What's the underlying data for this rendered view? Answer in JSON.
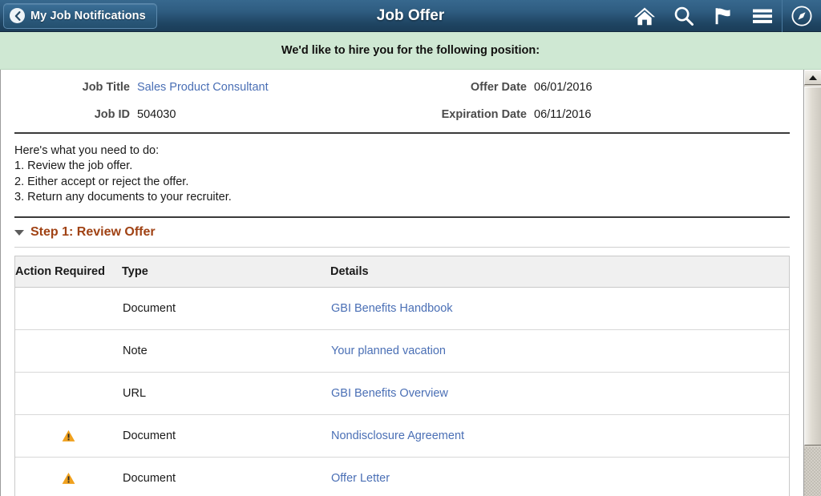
{
  "topbar": {
    "back_label": "My Job Notifications",
    "title": "Job Offer",
    "icons": [
      {
        "name": "home-icon",
        "label": "Home"
      },
      {
        "name": "search-icon",
        "label": "Search"
      },
      {
        "name": "flag-icon",
        "label": "Notifications"
      },
      {
        "name": "hamburger-menu-icon",
        "label": "Actions Menu"
      },
      {
        "name": "navigator-compass-icon",
        "label": "NavBar"
      }
    ]
  },
  "banner": {
    "text": "We'd like to hire you for the following position:"
  },
  "details": {
    "job_title_label": "Job Title",
    "job_title_value": "Sales Product Consultant",
    "job_id_label": "Job ID",
    "job_id_value": "504030",
    "offer_date_label": "Offer Date",
    "offer_date_value": "06/01/2016",
    "expiration_date_label": "Expiration Date",
    "expiration_date_value": "06/11/2016"
  },
  "instructions": {
    "heading": "Here's what you need to do:",
    "lines": [
      "1. Review the job offer.",
      "2. Either accept or reject the offer.",
      "3. Return any documents to your recruiter."
    ]
  },
  "step": {
    "title": "Step 1: Review Offer",
    "expanded": true
  },
  "table": {
    "columns": [
      "Action Required",
      "Type",
      "Details"
    ],
    "rows": [
      {
        "action_required": false,
        "type": "Document",
        "details": "GBI Benefits Handbook"
      },
      {
        "action_required": false,
        "type": "Note",
        "details": "Your planned vacation"
      },
      {
        "action_required": false,
        "type": "URL",
        "details": "GBI Benefits Overview"
      },
      {
        "action_required": true,
        "type": "Document",
        "details": "Nondisclosure Agreement"
      },
      {
        "action_required": true,
        "type": "Document",
        "details": "Offer Letter"
      }
    ]
  },
  "colors": {
    "header_blue": "#2f5d81",
    "banner_green": "#cfe8d3",
    "link_blue": "#4a6fb5",
    "step_orange": "#a04214",
    "warning_amber": "#f0a11e"
  }
}
